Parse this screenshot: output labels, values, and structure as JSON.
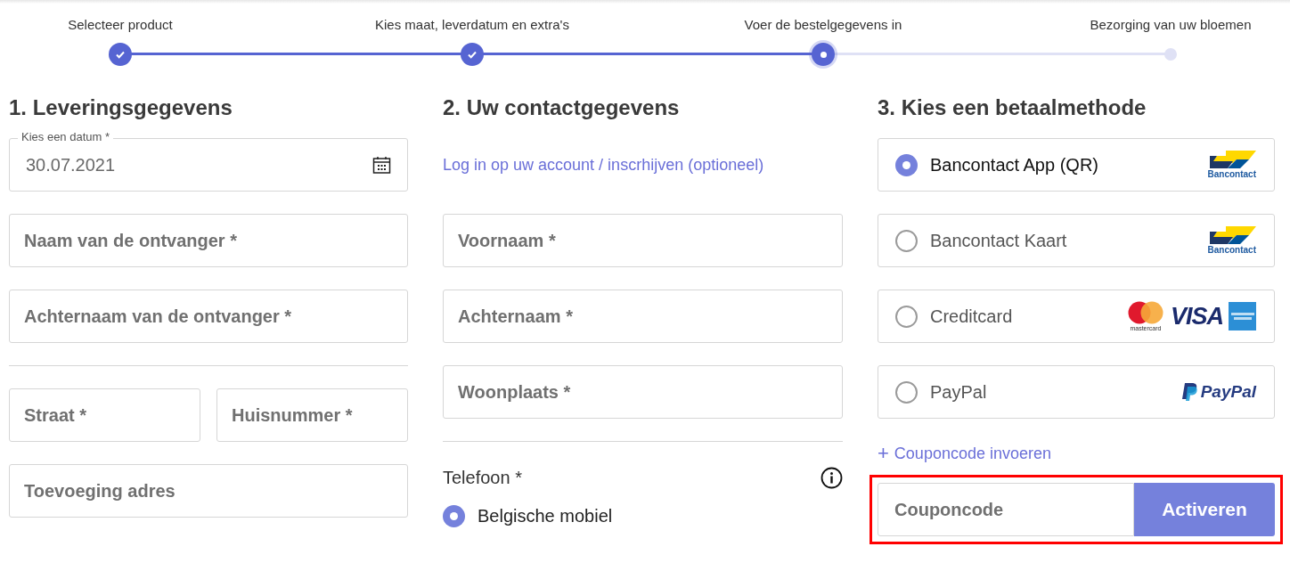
{
  "steps": [
    {
      "label": "Selecteer product",
      "done": true,
      "current": false
    },
    {
      "label": "Kies maat, leverdatum en extra's",
      "done": true,
      "current": false
    },
    {
      "label": "Voer de bestelgegevens in",
      "done": false,
      "current": true
    },
    {
      "label": "Bezorging van uw bloemen",
      "done": false,
      "current": false
    }
  ],
  "delivery": {
    "heading": "1. Leveringsgegevens",
    "date": {
      "label": "Kies een datum *",
      "value": "30.07.2021"
    },
    "recipient_fields": [
      {
        "placeholder": "Naam van de ontvanger *"
      },
      {
        "placeholder": "Achternaam van de ontvanger *"
      }
    ],
    "address_fields": [
      {
        "placeholder": "Straat *"
      },
      {
        "placeholder": "Huisnummer *"
      },
      {
        "placeholder": "Toevoeging adres"
      }
    ]
  },
  "contact": {
    "heading": "2. Uw contactgegevens",
    "login_link": "Log in op uw account / inscrhijven (optioneel)",
    "fields": [
      {
        "placeholder": "Voornaam *"
      },
      {
        "placeholder": "Achternaam *"
      },
      {
        "placeholder": "Woonplaats *"
      }
    ],
    "phone": {
      "label": "Telefoon *",
      "options": [
        {
          "label": "Belgische mobiel",
          "selected": true
        }
      ]
    }
  },
  "payment": {
    "heading": "3. Kies een betaalmethode",
    "methods": [
      {
        "label": "Bancontact App (QR)",
        "selected": true,
        "logos": [
          {
            "kind": "bancontact",
            "text": "Bancontact"
          }
        ]
      },
      {
        "label": "Bancontact Kaart",
        "selected": false,
        "logos": [
          {
            "kind": "bancontact",
            "text": "Bancontact"
          }
        ]
      },
      {
        "label": "Creditcard",
        "selected": false,
        "logos": [
          {
            "kind": "mastercard",
            "text": "mastercard"
          },
          {
            "kind": "visa",
            "text": "VISA"
          },
          {
            "kind": "amex"
          }
        ]
      },
      {
        "label": "PayPal",
        "selected": false,
        "logos": [
          {
            "kind": "paypal",
            "text": "PayPal"
          }
        ]
      }
    ],
    "coupon_link": {
      "icon": "+",
      "label": "Couponcode invoeren"
    },
    "coupon": {
      "placeholder": "Couponcode",
      "button": "Activeren",
      "highlighted": true
    }
  }
}
